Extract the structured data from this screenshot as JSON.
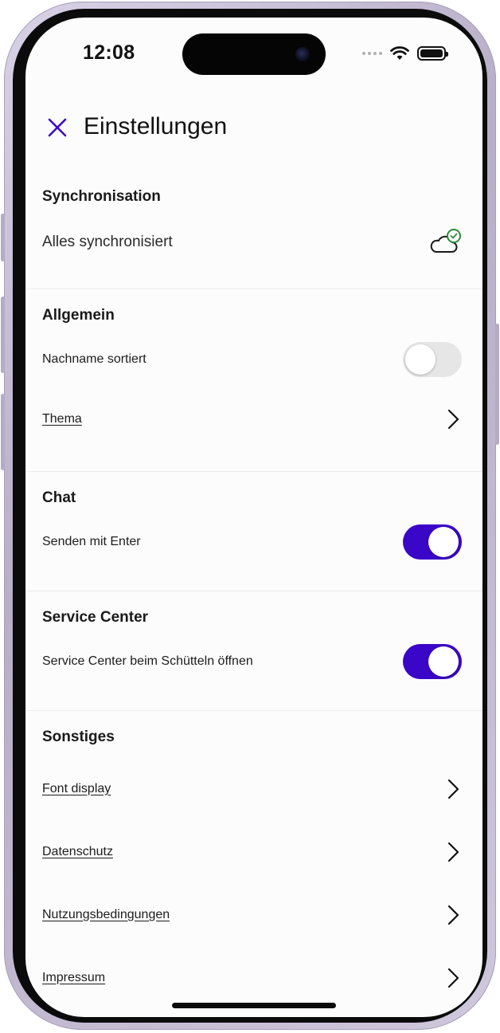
{
  "status_bar": {
    "time": "12:08"
  },
  "header": {
    "title": "Einstellungen"
  },
  "sections": {
    "sync": {
      "title": "Synchronisation",
      "status": "Alles synchronisiert"
    },
    "general": {
      "title": "Allgemein",
      "sort_label": "Nachname sortiert",
      "sort_enabled": false,
      "theme_label": "Thema"
    },
    "chat": {
      "title": "Chat",
      "send_enter_label": "Senden mit Enter",
      "send_enter_enabled": true
    },
    "service": {
      "title": "Service Center",
      "shake_label": "Service Center beim Schütteln öffnen",
      "shake_enabled": true
    },
    "other": {
      "title": "Sonstiges",
      "items": [
        "Font display",
        "Datenschutz",
        "Nutzungsbedingungen",
        "Impressum"
      ]
    }
  },
  "colors": {
    "accent": "#3a06c8",
    "toggle_off": "#e6e6e6",
    "sync_ok": "#2e8b3a"
  },
  "icons": {
    "close": "close-icon",
    "sync": "cloud-check-icon",
    "chevron": "chevron-right-icon"
  }
}
